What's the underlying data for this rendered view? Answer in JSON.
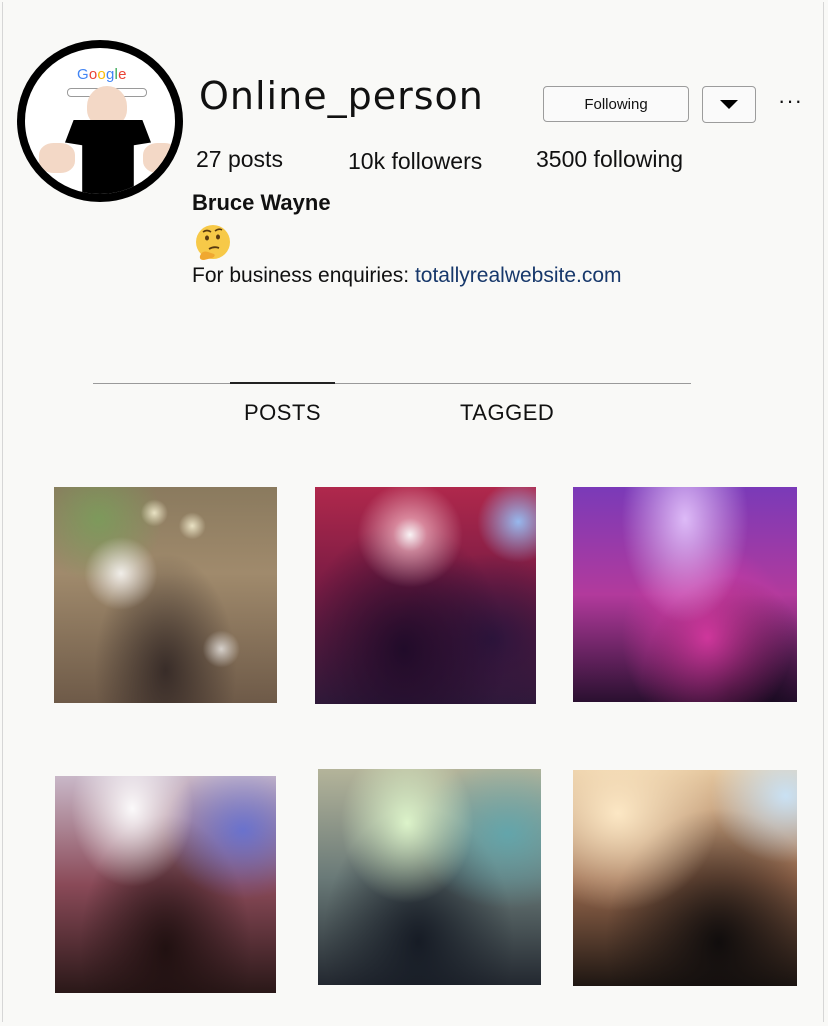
{
  "profile": {
    "avatar_logo": "Google",
    "username": "Online_person",
    "following_label": "Following",
    "dropdown_icon": "caret-down-icon",
    "more_label": "···",
    "stats": {
      "posts": "27 posts",
      "followers": "10k followers",
      "following": "3500 following"
    },
    "full_name": "Bruce Wayne",
    "bio_emoji": "thinking-face-emoji",
    "bio_text": "For business enquiries: ",
    "bio_link": "totallyrealwebsite.com"
  },
  "tabs": [
    {
      "label": "POSTS",
      "active": true
    },
    {
      "label": "TAGGED",
      "active": false
    }
  ],
  "posts": [
    {
      "alt": "blurred concert venue with lights"
    },
    {
      "alt": "crowd with red stage lights"
    },
    {
      "alt": "purple and pink concert crowd"
    },
    {
      "alt": "crowd under bright white stage lights"
    },
    {
      "alt": "crowd under green stage lights"
    },
    {
      "alt": "crowd silhouettes under warm light"
    }
  ],
  "colors": {
    "background": "#f9f9f7",
    "link": "#17386b",
    "border": "#9c9c9c"
  }
}
